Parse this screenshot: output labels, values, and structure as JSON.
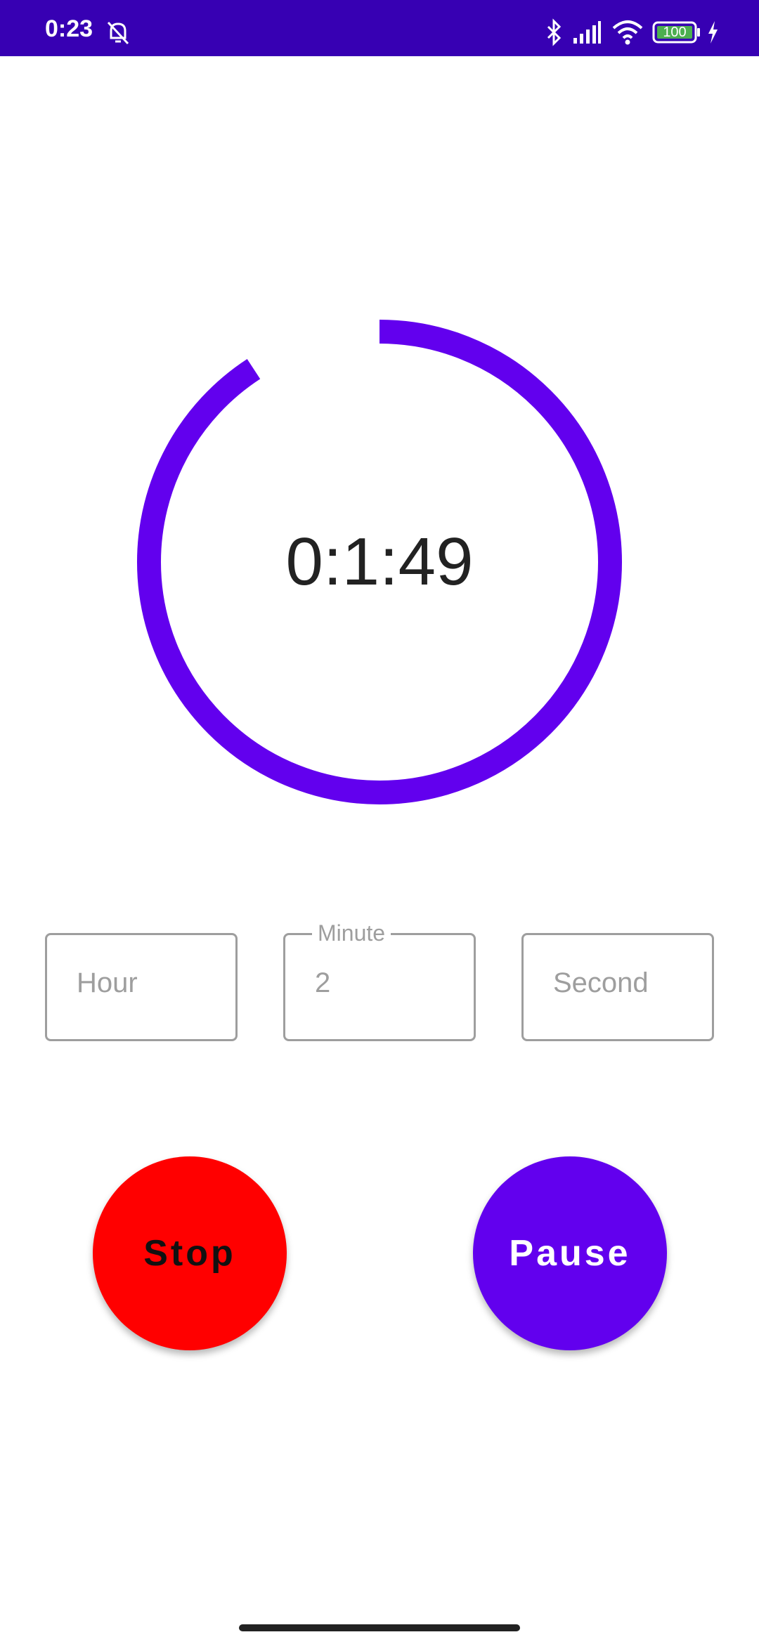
{
  "status_bar": {
    "time": "0:23",
    "battery": "100",
    "background_color": "#3700B3",
    "icons": [
      "muted-alarm-icon",
      "bluetooth-icon",
      "cellular-signal-icon",
      "wifi-icon",
      "battery-icon",
      "charging-icon"
    ]
  },
  "timer": {
    "display": "0:1:49",
    "progress_fraction": 0.908,
    "ring_color": "#6200EE"
  },
  "fields": {
    "hour": {
      "placeholder": "Hour",
      "value": ""
    },
    "minute": {
      "label": "Minute",
      "value": "2"
    },
    "second": {
      "placeholder": "Second",
      "value": ""
    }
  },
  "buttons": {
    "stop": {
      "label": "Stop",
      "color": "#FF0000"
    },
    "pause": {
      "label": "Pause",
      "color": "#6200EE"
    }
  }
}
